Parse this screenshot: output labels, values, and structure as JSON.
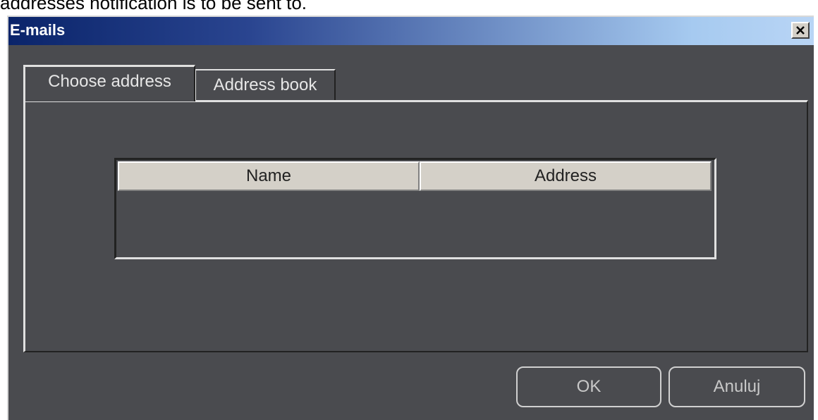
{
  "caption": "addresses notification is to be sent to.",
  "window": {
    "title": "E-mails",
    "close_icon": "close-x-icon"
  },
  "tabs": [
    {
      "label": "Choose address",
      "active": true
    },
    {
      "label": "Address book",
      "active": false
    }
  ],
  "table": {
    "columns": [
      "Name",
      "Address"
    ],
    "rows": []
  },
  "buttons": {
    "ok_label": "OK",
    "cancel_label": "Anuluj"
  },
  "colors": {
    "dialog_bg": "#4a4b4f",
    "titlebar_start": "#0a246a",
    "titlebar_end": "#b9d5f5",
    "header_bg": "#d4d0c8"
  }
}
